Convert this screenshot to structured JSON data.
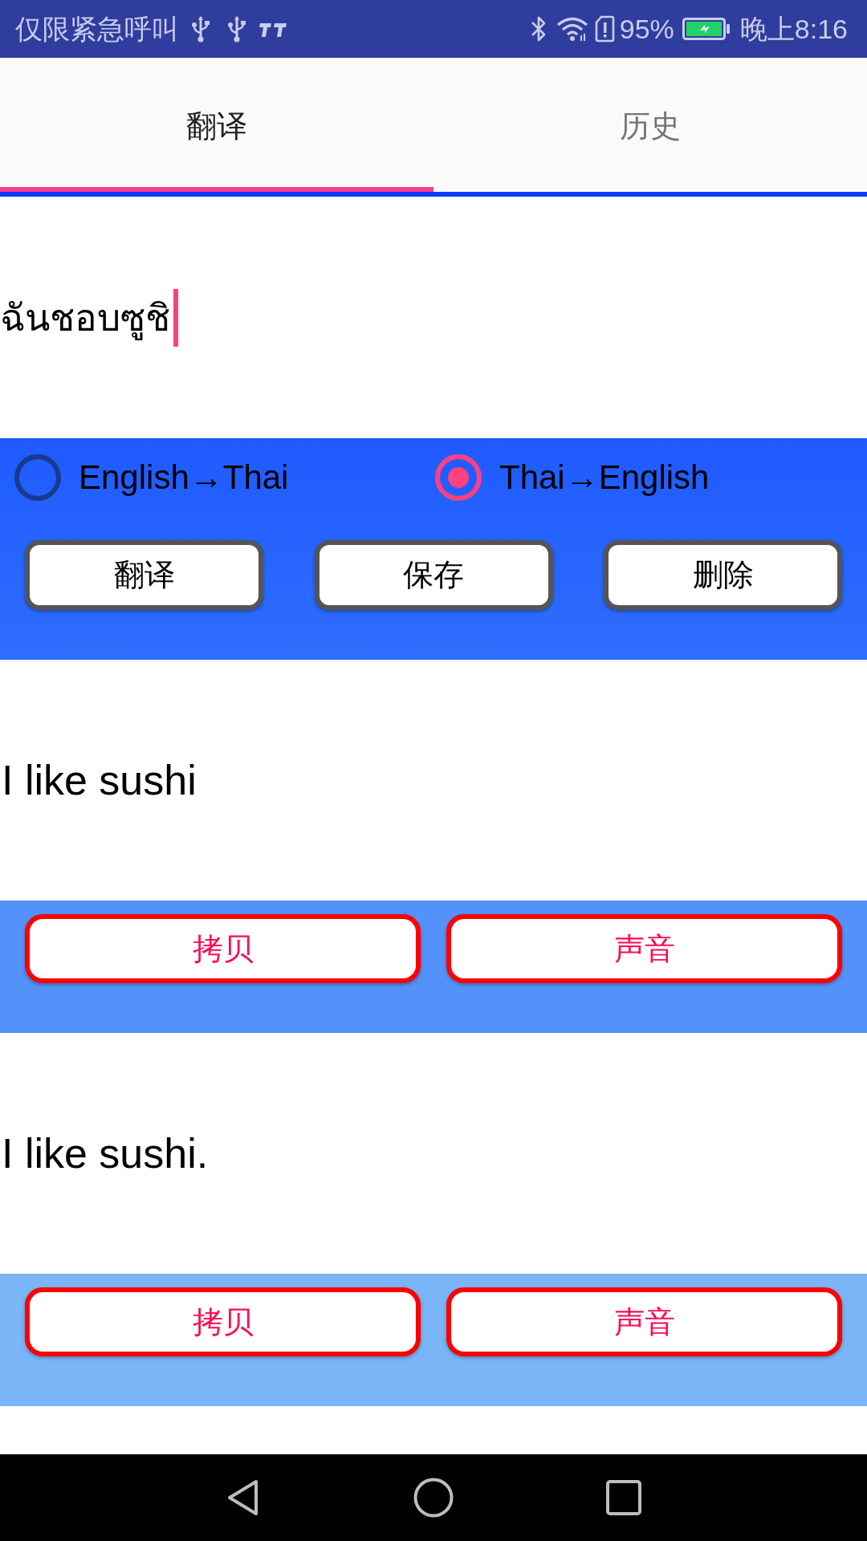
{
  "status_bar": {
    "carrier_text": "仅限紧急呼叫",
    "battery_percent": "95%",
    "time": "晚上8:16"
  },
  "tabs": [
    {
      "label": "翻译",
      "selected": true
    },
    {
      "label": "历史",
      "selected": false
    }
  ],
  "input": {
    "value": "ฉันชอบซูชิ",
    "focused": true
  },
  "direction_options": [
    {
      "label": "English→Thai",
      "selected": false
    },
    {
      "label": "Thai→English",
      "selected": true
    }
  ],
  "action_buttons": [
    "翻译",
    "保存",
    "删除"
  ],
  "results": [
    {
      "text": "I like sushi",
      "color": "#5292f9",
      "buttons": [
        "拷贝",
        "声音"
      ]
    },
    {
      "text": "I like sushi.",
      "color": "#79b5f7",
      "buttons": [
        "拷贝",
        "声音"
      ]
    }
  ]
}
